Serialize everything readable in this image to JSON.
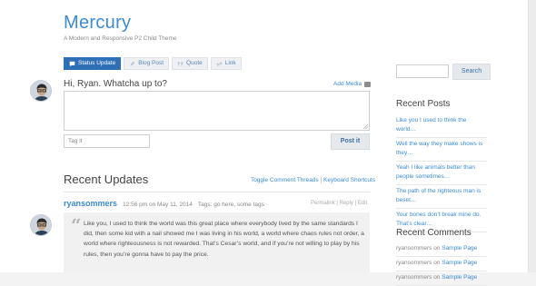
{
  "site": {
    "title": "Mercury",
    "description": "A Modern and Responsive P2 Child Theme"
  },
  "post_tabs": [
    {
      "label": "Status Update",
      "icon": "comment-icon",
      "active": true
    },
    {
      "label": "Blog Post",
      "icon": "pencil-icon",
      "active": false
    },
    {
      "label": "Quote",
      "icon": "quote-icon",
      "active": false
    },
    {
      "label": "Link",
      "icon": "link-icon",
      "active": false
    }
  ],
  "composer": {
    "prompt": "Hi, Ryan. Whatcha up to?",
    "add_media": "Add Media",
    "textarea_value": "",
    "tag_placeholder": "Tag it",
    "submit_label": "Post it"
  },
  "recent_updates": {
    "heading": "Recent Updates",
    "toggle_threads": "Toggle Comment Threads",
    "separator": "|",
    "keyboard_shortcuts": "Keyboard Shortcuts"
  },
  "entry": {
    "author": "ryansommers",
    "timestamp": "12:56 pm on May 11, 2014",
    "tags": "Tags: go here, some tags",
    "actions": "Permalink | Reply | Edit",
    "quote": "Like you, I used to think the world was this great place where everybody lived by the same standards I did, then some kid with a nail showed me I was living in his world, a world where chaos rules not order, a world where righteousness is not rewarded. That’s Cesar’s world, and if you’re not willing to play by his rules, then you’re gonna have to pay the price."
  },
  "sidebar": {
    "search_placeholder": "",
    "search_button": "Search",
    "recent_posts_heading": "Recent Posts",
    "recent_posts": [
      "Like you I used to think the world…",
      "Well the way they make shows is they…",
      "Yeah I like animals better than people sometimes…",
      "The path of the righteous man is beset…",
      "Your bones don’t break mine do. That’s clear…"
    ],
    "recent_comments_heading": "Recent Comments",
    "recent_comments": [
      {
        "author": "ryansommers",
        "on": "on",
        "post": "Sample Page"
      },
      {
        "author": "ryansommers",
        "on": "on",
        "post": "Sample Page"
      },
      {
        "author": "ryansommers",
        "on": "on",
        "post": "Sample Page"
      }
    ]
  },
  "colors": {
    "accent": "#3a8bd8",
    "active_tab": "#2f6fb8",
    "button_bg": "#e6e9ec"
  }
}
